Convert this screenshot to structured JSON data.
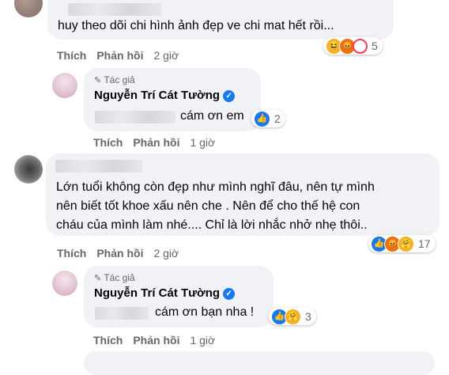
{
  "comments": [
    {
      "text_lines": [
        "huy theo dõi chi hình ảnh đẹp ve chi mat hết rồi..."
      ],
      "actions": {
        "like": "Thích",
        "reply": "Phản hồi",
        "time": "2 giờ"
      },
      "reaction_count": "5",
      "reaction_icons": [
        "haha-icon",
        "angry-icon",
        "love-icon"
      ]
    },
    {
      "author_badge": "Tác giả",
      "name": "Nguyễn Trí Cát Tường",
      "text": "cám ơn em",
      "actions": {
        "like": "Thích",
        "reply": "Phản hồi",
        "time": "1 giờ"
      },
      "reaction_count": "2",
      "reaction_icons": [
        "like-icon"
      ]
    },
    {
      "text_lines": [
        "Lớn tuổi không còn đẹp như mình nghĩ đâu, nên tự mình",
        "nên biết tốt khoe xấu nên che . Nên để cho thế hệ con",
        "cháu của mình làm nhé.... Chỉ là lời nhắc nhở nhẹ thôi.."
      ],
      "actions": {
        "like": "Thích",
        "reply": "Phản hồi",
        "time": "2 giờ"
      },
      "reaction_count": "17",
      "reaction_icons": [
        "like-icon",
        "angry-icon",
        "care-icon"
      ]
    },
    {
      "author_badge": "Tác giả",
      "name": "Nguyễn Trí Cát Tường",
      "text": "cám ơn bạn nha !",
      "actions": {
        "like": "Thích",
        "reply": "Phản hồi",
        "time": "1 giờ"
      },
      "reaction_count": "3",
      "reaction_icons": [
        "like-icon",
        "care-icon"
      ]
    }
  ],
  "colors": {
    "bubble": "#f0f2f5",
    "meta": "#65676b",
    "like": "#1877f2",
    "text": "#050505"
  }
}
